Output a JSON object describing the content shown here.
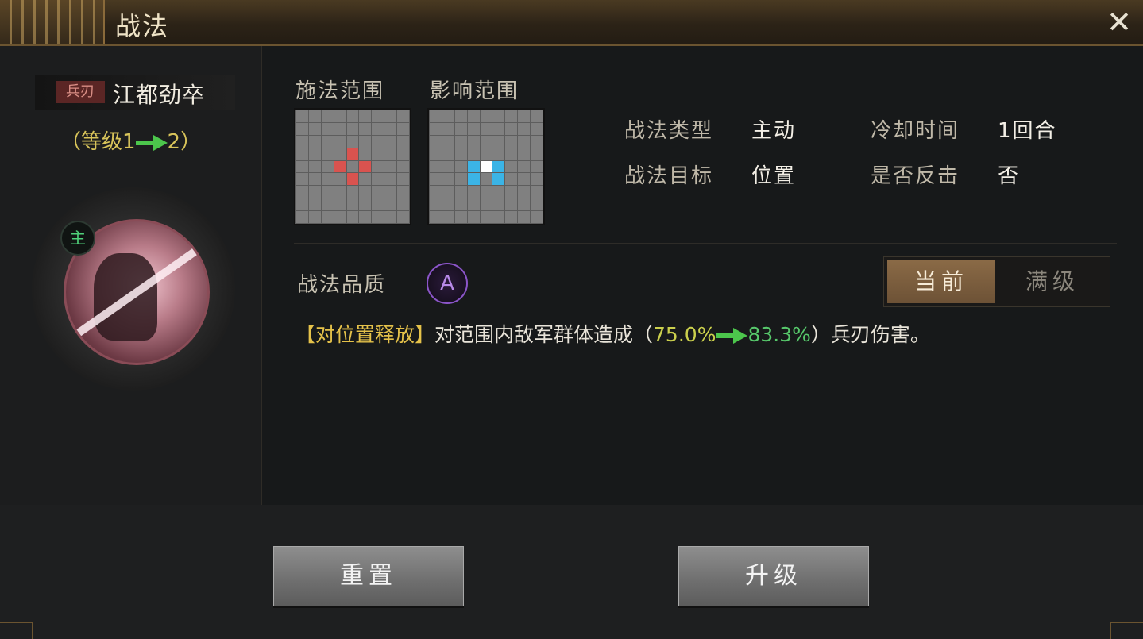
{
  "window": {
    "title": "战法",
    "close_label": "✕"
  },
  "skill": {
    "weapon_tag": "兵刃",
    "name": "江都劲卒",
    "level_prefix": "（等级1",
    "level_suffix": "2）",
    "main_badge": "主"
  },
  "ranges": {
    "cast_label": "施法范围",
    "effect_label": "影响范围",
    "cast_cells": [
      [
        3,
        4
      ],
      [
        4,
        3
      ],
      [
        4,
        5
      ],
      [
        5,
        4
      ]
    ],
    "effect_cells_blue": [
      [
        4,
        3
      ],
      [
        4,
        5
      ],
      [
        5,
        3
      ],
      [
        5,
        5
      ]
    ],
    "effect_cells_white": [
      [
        4,
        4
      ]
    ],
    "colors": {
      "cast": "#d9534f",
      "effect_blue": "#3bb4e6",
      "effect_white": "#ffffff",
      "grid": "#808080"
    }
  },
  "info": {
    "type_label": "战法类型",
    "type_value": "主动",
    "cooldown_label": "冷却时间",
    "cooldown_value": "1回合",
    "target_label": "战法目标",
    "target_value": "位置",
    "counter_label": "是否反击",
    "counter_value": "否"
  },
  "quality": {
    "label": "战法品质",
    "grade": "A"
  },
  "toggle": {
    "current": "当前",
    "max": "满级"
  },
  "description": {
    "tag": "【对位置释放】",
    "text1": "对范围内敌军群体造成（",
    "from": "75.0%",
    "to": "83.3%",
    "text2": "）兵刃伤害。"
  },
  "buttons": {
    "reset": "重置",
    "upgrade": "升级"
  }
}
